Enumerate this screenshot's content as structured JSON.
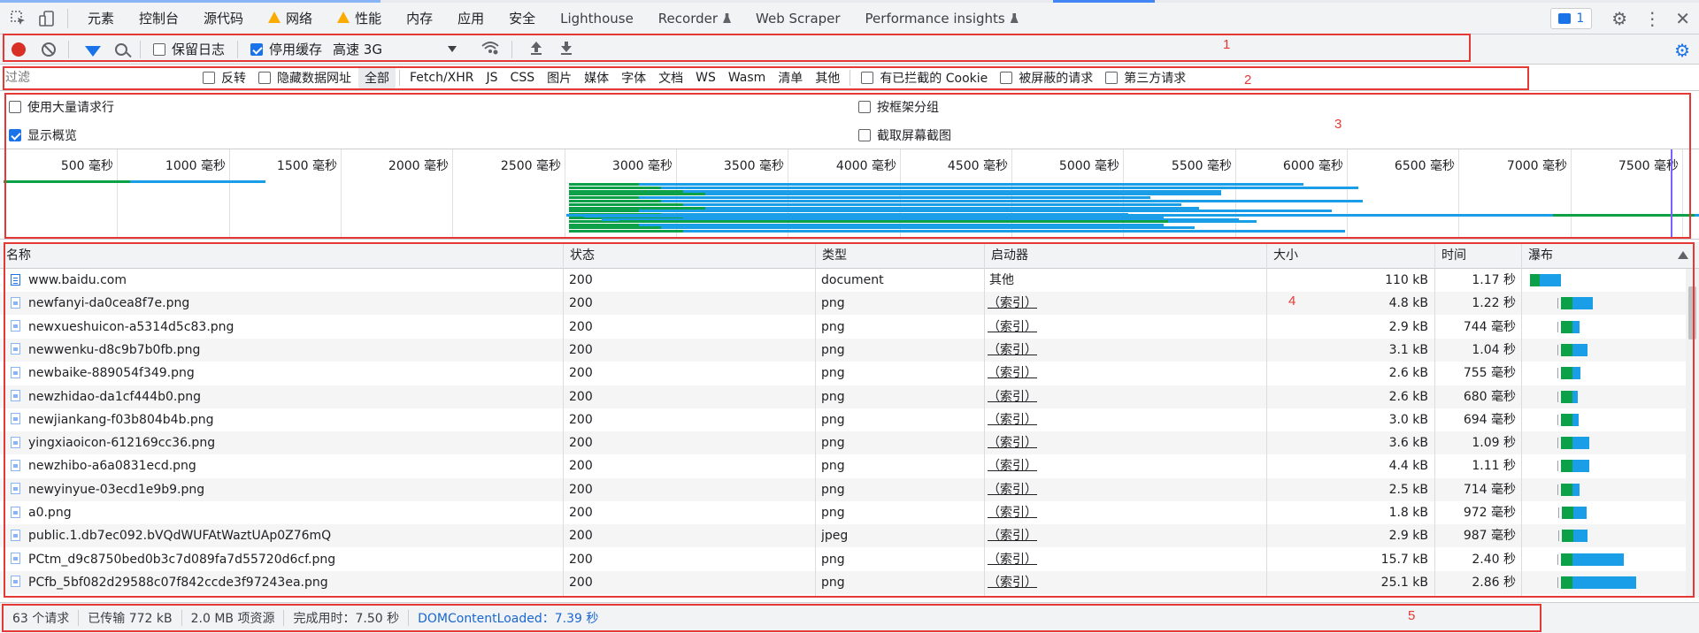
{
  "tabbar": {
    "tabs": [
      {
        "label": "元素",
        "warn": false,
        "flask": false
      },
      {
        "label": "控制台",
        "warn": false,
        "flask": false
      },
      {
        "label": "源代码",
        "warn": false,
        "flask": false
      },
      {
        "label": "网络",
        "warn": true,
        "flask": false
      },
      {
        "label": "性能",
        "warn": true,
        "flask": false
      },
      {
        "label": "内存",
        "warn": false,
        "flask": false
      },
      {
        "label": "应用",
        "warn": false,
        "flask": false
      },
      {
        "label": "安全",
        "warn": false,
        "flask": false
      },
      {
        "label": "Lighthouse",
        "warn": false,
        "flask": false
      },
      {
        "label": "Recorder",
        "warn": false,
        "flask": true
      },
      {
        "label": "Web Scraper",
        "warn": false,
        "flask": false
      },
      {
        "label": "Performance insights",
        "warn": false,
        "flask": true
      }
    ],
    "issues_count": "1",
    "icons": {
      "inspect": "inspect-element-icon",
      "device": "device-toolbar-icon",
      "settings": "gear-icon",
      "more": "kebab-menu-icon",
      "close": "close-icon"
    }
  },
  "toolbar": {
    "preserve_log_label": "保留日志",
    "preserve_log_checked": false,
    "disable_cache_label": "停用缓存",
    "disable_cache_checked": true,
    "throttle_value": "高速 3G"
  },
  "filterbar": {
    "filter_placeholder": "过滤",
    "invert_label": "反转",
    "hide_data_urls_label": "隐藏数据网址",
    "types": [
      "全部",
      "Fetch/XHR",
      "JS",
      "CSS",
      "图片",
      "媒体",
      "字体",
      "文档",
      "WS",
      "Wasm",
      "清单",
      "其他"
    ],
    "selected_type": "全部",
    "blocked_cookies_label": "有已拦截的 Cookie",
    "blocked_requests_label": "被屏蔽的请求",
    "third_party_label": "第三方请求"
  },
  "settings": {
    "big_rows_label": "使用大量请求行",
    "big_rows_checked": false,
    "show_overview_label": "显示概览",
    "show_overview_checked": true,
    "group_by_frame_label": "按框架分组",
    "group_by_frame_checked": false,
    "capture_screenshots_label": "截取屏幕截图",
    "capture_screenshots_checked": false
  },
  "overview": {
    "ticks": [
      "500 毫秒",
      "1000 毫秒",
      "1500 毫秒",
      "2000 毫秒",
      "2500 毫秒",
      "3000 毫秒",
      "3500 毫秒",
      "4000 毫秒",
      "4500 毫秒",
      "5000 毫秒",
      "5500 毫秒",
      "6000 毫秒",
      "6500 毫秒",
      "7000 毫秒",
      "7500 毫秒"
    ],
    "colors": {
      "green": "#0ca048",
      "blue": "#1a9ee8",
      "marker": "#7b61ff"
    }
  },
  "table": {
    "headers": {
      "name": "名称",
      "status": "状态",
      "type": "类型",
      "initiator": "启动器",
      "size": "大小",
      "time": "时间",
      "waterfall": "瀑布"
    },
    "rows": [
      {
        "name": "www.baidu.com",
        "status": "200",
        "type": "document",
        "initiator": "其他",
        "initiator_link": false,
        "size": "110 kB",
        "time": "1.17 秒",
        "icon": "document-icon",
        "wf_start": 0.0,
        "wf_wait": 0.35,
        "wf_total": 1.17
      },
      {
        "name": "newfanyi-da0cea8f7e.png",
        "status": "200",
        "type": "png",
        "initiator": "（索引）",
        "initiator_link": true,
        "size": "4.8 kB",
        "time": "1.22 秒",
        "icon": "image-icon",
        "wf_start": 1.05,
        "wf_wait": 0.45,
        "wf_total": 1.22
      },
      {
        "name": "newxueshuicon-a5314d5c83.png",
        "status": "200",
        "type": "png",
        "initiator": "（索引）",
        "initiator_link": true,
        "size": "2.9 kB",
        "time": "744 毫秒",
        "icon": "image-icon",
        "wf_start": 1.05,
        "wf_wait": 0.45,
        "wf_total": 0.744
      },
      {
        "name": "newwenku-d8c9b7b0fb.png",
        "status": "200",
        "type": "png",
        "initiator": "（索引）",
        "initiator_link": true,
        "size": "3.1 kB",
        "time": "1.04 秒",
        "icon": "image-icon",
        "wf_start": 1.05,
        "wf_wait": 0.45,
        "wf_total": 1.04
      },
      {
        "name": "newbaike-889054f349.png",
        "status": "200",
        "type": "png",
        "initiator": "（索引）",
        "initiator_link": true,
        "size": "2.6 kB",
        "time": "755 毫秒",
        "icon": "image-icon",
        "wf_start": 1.05,
        "wf_wait": 0.45,
        "wf_total": 0.755
      },
      {
        "name": "newzhidao-da1cf444b0.png",
        "status": "200",
        "type": "png",
        "initiator": "（索引）",
        "initiator_link": true,
        "size": "2.6 kB",
        "time": "680 毫秒",
        "icon": "image-icon",
        "wf_start": 1.05,
        "wf_wait": 0.45,
        "wf_total": 0.68
      },
      {
        "name": "newjiankang-f03b804b4b.png",
        "status": "200",
        "type": "png",
        "initiator": "（索引）",
        "initiator_link": true,
        "size": "3.0 kB",
        "time": "694 毫秒",
        "icon": "image-icon",
        "wf_start": 1.05,
        "wf_wait": 0.45,
        "wf_total": 0.694
      },
      {
        "name": "yingxiaoicon-612169cc36.png",
        "status": "200",
        "type": "png",
        "initiator": "（索引）",
        "initiator_link": true,
        "size": "3.6 kB",
        "time": "1.09 秒",
        "icon": "image-icon",
        "wf_start": 1.05,
        "wf_wait": 0.45,
        "wf_total": 1.09
      },
      {
        "name": "newzhibo-a6a0831ecd.png",
        "status": "200",
        "type": "png",
        "initiator": "（索引）",
        "initiator_link": true,
        "size": "4.4 kB",
        "time": "1.11 秒",
        "icon": "image-icon",
        "wf_start": 1.05,
        "wf_wait": 0.45,
        "wf_total": 1.11
      },
      {
        "name": "newyinyue-03ecd1e9b9.png",
        "status": "200",
        "type": "png",
        "initiator": "（索引）",
        "initiator_link": true,
        "size": "2.5 kB",
        "time": "714 毫秒",
        "icon": "image-icon",
        "wf_start": 1.05,
        "wf_wait": 0.45,
        "wf_total": 0.714
      },
      {
        "name": "a0.png",
        "status": "200",
        "type": "png",
        "initiator": "（索引）",
        "initiator_link": true,
        "size": "1.8 kB",
        "time": "972 毫秒",
        "icon": "image-icon",
        "wf_start": 1.08,
        "wf_wait": 0.45,
        "wf_total": 0.972
      },
      {
        "name": "public.1.db7ec092.bVQdWUFAtWaztUAp0Z76mQ",
        "status": "200",
        "type": "jpeg",
        "initiator": "（索引）",
        "initiator_link": true,
        "size": "2.9 kB",
        "time": "987 毫秒",
        "icon": "image-icon",
        "wf_start": 1.08,
        "wf_wait": 0.45,
        "wf_total": 0.987
      },
      {
        "name": "PCtm_d9c8750bed0b3c7d089fa7d55720d6cf.png",
        "status": "200",
        "type": "png",
        "initiator": "（索引）",
        "initiator_link": true,
        "size": "15.7 kB",
        "time": "2.40 秒",
        "icon": "image-icon",
        "wf_start": 1.05,
        "wf_wait": 0.45,
        "wf_total": 2.4
      },
      {
        "name": "PCfb_5bf082d29588c07f842ccde3f97243ea.png",
        "status": "200",
        "type": "png",
        "initiator": "（索引）",
        "initiator_link": true,
        "size": "25.1 kB",
        "time": "2.86 秒",
        "icon": "image-icon",
        "wf_start": 1.05,
        "wf_wait": 0.45,
        "wf_total": 2.86
      }
    ]
  },
  "status": {
    "requests": "63 个请求",
    "transferred": "已传输 772 kB",
    "resources": "2.0 MB 项资源",
    "finish": "完成用时：7.50 秒",
    "dcl": "DOMContentLoaded：7.39 秒"
  },
  "annotations": [
    "1",
    "2",
    "3",
    "4",
    "5"
  ]
}
